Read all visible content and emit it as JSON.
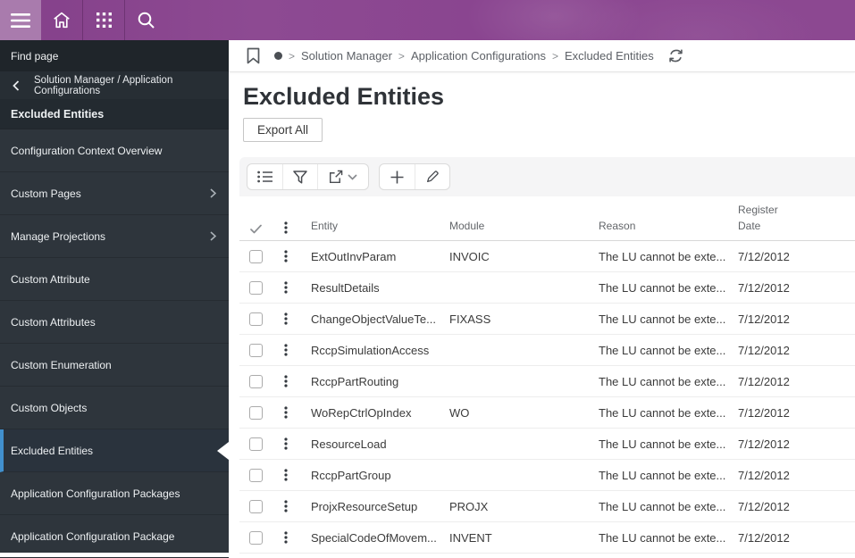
{
  "topbar": {
    "icons": [
      "hamburger-menu-icon",
      "home-icon",
      "app-grid-icon",
      "search-icon"
    ]
  },
  "sidebar": {
    "find_page_label": "Find page",
    "back_label": "Solution Manager / Application Configurations",
    "section_title": "Excluded Entities",
    "items": [
      {
        "label": "Configuration Context Overview",
        "expandable": false,
        "selected": false
      },
      {
        "label": "Custom Pages",
        "expandable": true,
        "selected": false
      },
      {
        "label": "Manage Projections",
        "expandable": true,
        "selected": false
      },
      {
        "label": "Custom Attribute",
        "expandable": false,
        "selected": false
      },
      {
        "label": "Custom Attributes",
        "expandable": false,
        "selected": false
      },
      {
        "label": "Custom Enumeration",
        "expandable": false,
        "selected": false
      },
      {
        "label": "Custom Objects",
        "expandable": false,
        "selected": false
      },
      {
        "label": "Excluded Entities",
        "expandable": false,
        "selected": true
      },
      {
        "label": "Application Configuration Packages",
        "expandable": false,
        "selected": false
      },
      {
        "label": "Application Configuration Package",
        "expandable": false,
        "selected": false
      }
    ]
  },
  "breadcrumb": {
    "icons": [
      "bookmark-icon",
      "record-dot-icon",
      "refresh-icon"
    ],
    "items": [
      "Solution Manager",
      "Application Configurations",
      "Excluded Entities"
    ]
  },
  "page": {
    "title": "Excluded Entities",
    "export_all_label": "Export All",
    "toolbar_icons": [
      "list-view-icon",
      "filter-icon",
      "share-icon",
      "chevron-down-icon",
      "add-icon",
      "edit-icon"
    ]
  },
  "table": {
    "header": {
      "check": "✓",
      "entity": "Entity",
      "module": "Module",
      "reason": "Reason",
      "register_line1": "Register",
      "register_line2": "Date"
    },
    "rows": [
      {
        "entity": "ExtOutInvParam",
        "module": "INVOIC",
        "reason": "The LU cannot be exte...",
        "register_date": "7/12/2012"
      },
      {
        "entity": "ResultDetails",
        "module": "",
        "reason": "The LU cannot be exte...",
        "register_date": "7/12/2012"
      },
      {
        "entity": "ChangeObjectValueTe...",
        "module": "FIXASS",
        "reason": "The LU cannot be exte...",
        "register_date": "7/12/2012"
      },
      {
        "entity": "RccpSimulationAccess",
        "module": "",
        "reason": "The LU cannot be exte...",
        "register_date": "7/12/2012"
      },
      {
        "entity": "RccpPartRouting",
        "module": "",
        "reason": "The LU cannot be exte...",
        "register_date": "7/12/2012"
      },
      {
        "entity": "WoRepCtrlOpIndex",
        "module": "WO",
        "reason": "The LU cannot be exte...",
        "register_date": "7/12/2012"
      },
      {
        "entity": "ResourceLoad",
        "module": "",
        "reason": "The LU cannot be exte...",
        "register_date": "7/12/2012"
      },
      {
        "entity": "RccpPartGroup",
        "module": "",
        "reason": "The LU cannot be exte...",
        "register_date": "7/12/2012"
      },
      {
        "entity": "ProjxResourceSetup",
        "module": "PROJX",
        "reason": "The LU cannot be exte...",
        "register_date": "7/12/2012"
      },
      {
        "entity": "SpecialCodeOfMovem...",
        "module": "INVENT",
        "reason": "The LU cannot be exte...",
        "register_date": "7/12/2012"
      }
    ]
  },
  "colors": {
    "topbar_purple": "#8A4590",
    "topbar_hamburger_purple": "#A97BAD",
    "sidebar_bg": "#2E353C",
    "selected_item_bg": "#2A333D",
    "selected_accent_blue": "#4190CE"
  }
}
